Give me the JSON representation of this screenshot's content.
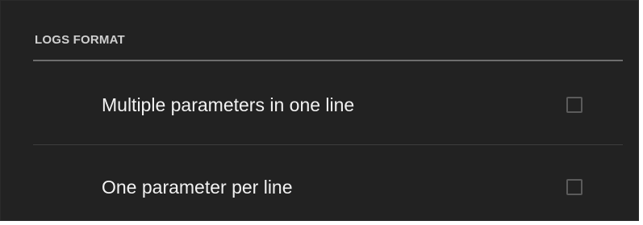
{
  "section": {
    "title": "LOGS FORMAT"
  },
  "options": [
    {
      "label": "Multiple parameters in one line",
      "checked": false
    },
    {
      "label": "One parameter per line",
      "checked": false
    }
  ],
  "colors": {
    "panel_background": "#222222",
    "section_header_text": "#cfcfcf",
    "option_text": "#f2f2f2",
    "rule": "#6d6d6d",
    "checkbox_border": "#5b5b5b"
  }
}
